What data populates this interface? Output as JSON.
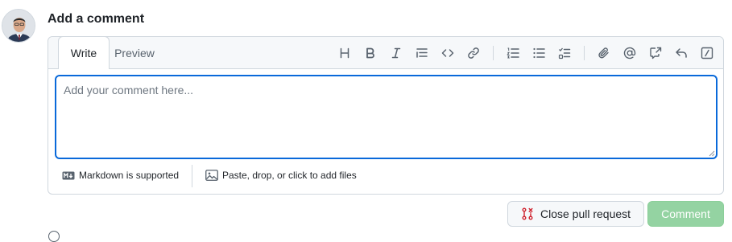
{
  "heading": "Add a comment",
  "tabs": {
    "write": "Write",
    "preview": "Preview"
  },
  "toolbar": {
    "icons": [
      "heading-icon",
      "bold-icon",
      "italic-icon",
      "quote-icon",
      "code-icon",
      "link-icon",
      "ordered-list-icon",
      "unordered-list-icon",
      "task-list-icon",
      "attach-icon",
      "mention-icon",
      "cross-reference-icon",
      "saved-reply-icon",
      "slash-command-icon"
    ]
  },
  "editor": {
    "placeholder": "Add your comment here...",
    "value": ""
  },
  "footer": {
    "markdown": "Markdown is supported",
    "files": "Paste, drop, or click to add files"
  },
  "actions": {
    "close_pr": "Close pull request",
    "comment": "Comment"
  },
  "colors": {
    "accent": "#0969da",
    "comment_button": "#94d3a2",
    "close_icon": "#cf222e"
  }
}
